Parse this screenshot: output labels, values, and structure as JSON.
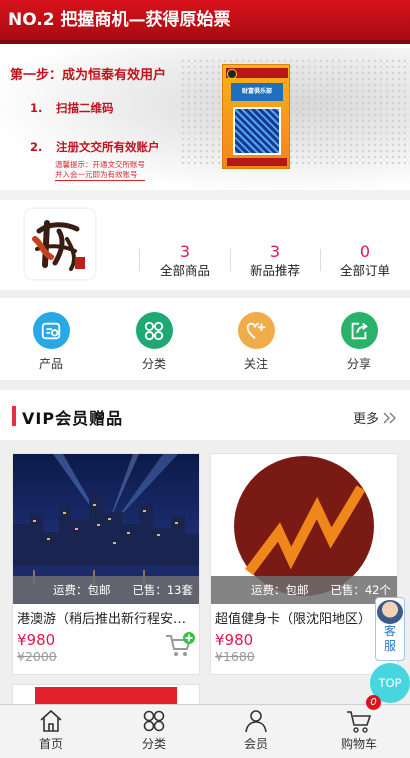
{
  "banner": {
    "headline": "NO.2 把握商机—获得原始票",
    "step_title": "第一步：成为恒泰有效用户",
    "step1": {
      "num": "1.",
      "text": "扫描二维码"
    },
    "step2": {
      "num": "2.",
      "text": "注册文交所有效账户"
    },
    "note_line1": "温馨提示：开通文交所账号",
    "note_line2": "并入会一元即为有效账号",
    "poster_title": "财富俱乐部"
  },
  "carousel": {
    "count": 5,
    "active_index": 0
  },
  "shop": {
    "stats": [
      {
        "value": "3",
        "label": "全部商品"
      },
      {
        "value": "3",
        "label": "新品推荐"
      },
      {
        "value": "0",
        "label": "全部订单"
      }
    ]
  },
  "quicknav": [
    {
      "label": "产品",
      "icon": "product-icon",
      "color": "#2aa7e6"
    },
    {
      "label": "分类",
      "icon": "category-icon",
      "color": "#1fa874"
    },
    {
      "label": "关注",
      "icon": "follow-icon",
      "color": "#f0ac4a"
    },
    {
      "label": "分享",
      "icon": "share-icon",
      "color": "#29b36a"
    }
  ],
  "vip": {
    "title": "VIP会员赠品",
    "more_label": "更多"
  },
  "products": [
    {
      "shipping": "运费：包邮",
      "sold": "已售：13套",
      "title": "港澳游（稍后推出新行程安排）",
      "price": "¥980",
      "original_price": "¥2000"
    },
    {
      "shipping": "运费：包邮",
      "sold": "已售：42个",
      "title": "超值健身卡（限沈阳地区）",
      "price": "¥980",
      "original_price": "¥1680"
    }
  ],
  "floating": {
    "service_label_1": "客",
    "service_label_2": "服",
    "top_label": "TOP"
  },
  "tabbar": {
    "tabs": [
      {
        "label": "首页",
        "icon": "home-icon"
      },
      {
        "label": "分类",
        "icon": "category-icon"
      },
      {
        "label": "会员",
        "icon": "member-icon"
      },
      {
        "label": "购物车",
        "icon": "cart-icon"
      }
    ],
    "cart_badge": "0"
  },
  "colors": {
    "accent_red": "#e3184a",
    "banner_red": "#d9111c",
    "top_button": "#47d6e0"
  }
}
